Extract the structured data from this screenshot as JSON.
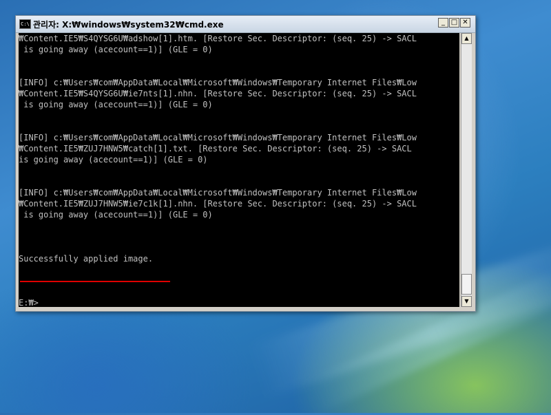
{
  "window": {
    "title": "관리자: X:₩windows₩system32₩cmd.exe",
    "icon_text": "C:\\",
    "controls": {
      "minimize": "_",
      "maximize": "□",
      "close": "✕"
    }
  },
  "console": {
    "lines": [
      "₩Content.IE5₩S4QYSG6U₩adshow[1].htm. [Restore Sec. Descriptor: (seq. 25) -> SACL",
      " is going away (acecount==1)] (GLE = 0)",
      "",
      "",
      "[INFO] c:₩Users₩com₩AppData₩Local₩Microsoft₩Windows₩Temporary Internet Files₩Low",
      "₩Content.IE5₩S4QYSG6U₩ie7nts[1].nhn. [Restore Sec. Descriptor: (seq. 25) -> SACL",
      " is going away (acecount==1)] (GLE = 0)",
      "",
      "",
      "[INFO] c:₩Users₩com₩AppData₩Local₩Microsoft₩Windows₩Temporary Internet Files₩Low",
      "₩Content.IE5₩ZUJ7HNW5₩catch[1].txt. [Restore Sec. Descriptor: (seq. 25) -> SACL",
      "is going away (acecount==1)] (GLE = 0)",
      "",
      "",
      "[INFO] c:₩Users₩com₩AppData₩Local₩Microsoft₩Windows₩Temporary Internet Files₩Low",
      "₩Content.IE5₩ZUJ7HNW5₩ie7c1k[1].nhn. [Restore Sec. Descriptor: (seq. 25) -> SACL",
      " is going away (acecount==1)] (GLE = 0)",
      "",
      "",
      "",
      "Successfully applied image.",
      "",
      "",
      "",
      "E:₩>"
    ]
  },
  "scrollbar": {
    "up_arrow": "▲",
    "down_arrow": "▼"
  },
  "colors": {
    "console_text": "#c0c0c0",
    "console_bg": "#000000",
    "highlight_underline": "#e00000"
  }
}
